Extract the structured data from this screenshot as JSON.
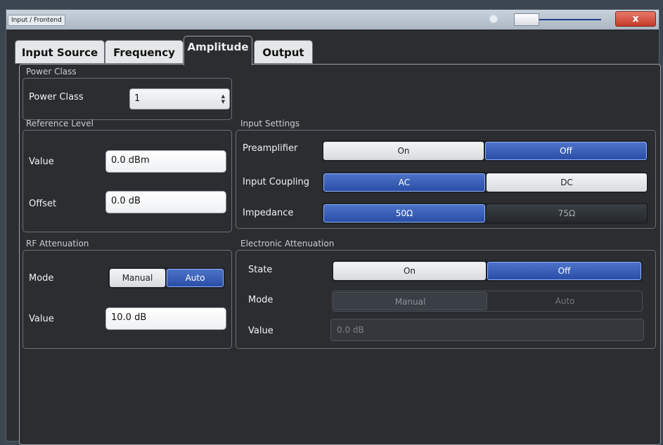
{
  "window": {
    "title": "Input / Frontend"
  },
  "titlebar": {
    "close_label": "x",
    "brightness_icon": "brightness-icon"
  },
  "tabs": [
    {
      "label": "Input Source",
      "active": false
    },
    {
      "label": "Frequency",
      "active": false
    },
    {
      "label": "Amplitude",
      "active": true
    },
    {
      "label": "Output",
      "active": false
    }
  ],
  "power_class": {
    "legend": "Power Class",
    "label": "Power Class",
    "value": "1"
  },
  "reference_level": {
    "legend": "Reference Level",
    "value_label": "Value",
    "value": "0.0 dBm",
    "offset_label": "Offset",
    "offset": "0.0 dB"
  },
  "rf_attenuation": {
    "legend": "RF Attenuation",
    "mode_label": "Mode",
    "mode_options": [
      "Manual",
      "Auto"
    ],
    "mode_selected": "Auto",
    "value_label": "Value",
    "value": "10.0 dB"
  },
  "input_settings": {
    "legend": "Input Settings",
    "preamp_label": "Preamplifier",
    "preamp_options": [
      "On",
      "Off"
    ],
    "preamp_selected": "Off",
    "coupling_label": "Input Coupling",
    "coupling_options": [
      "AC",
      "DC"
    ],
    "coupling_selected": "AC",
    "impedance_label": "Impedance",
    "impedance_options": [
      "50Ω",
      "75Ω"
    ],
    "impedance_selected": "50Ω"
  },
  "electronic_attenuation": {
    "legend": "Electronic Attenuation",
    "state_label": "State",
    "state_options": [
      "On",
      "Off"
    ],
    "state_selected": "Off",
    "mode_label": "Mode",
    "mode_options": [
      "Manual",
      "Auto"
    ],
    "value_label": "Value",
    "value": "0.0 dB"
  },
  "colors": {
    "accent_blue": "#2a4ea6",
    "panel_bg": "#2b2d31",
    "close_red": "#c33a28"
  }
}
